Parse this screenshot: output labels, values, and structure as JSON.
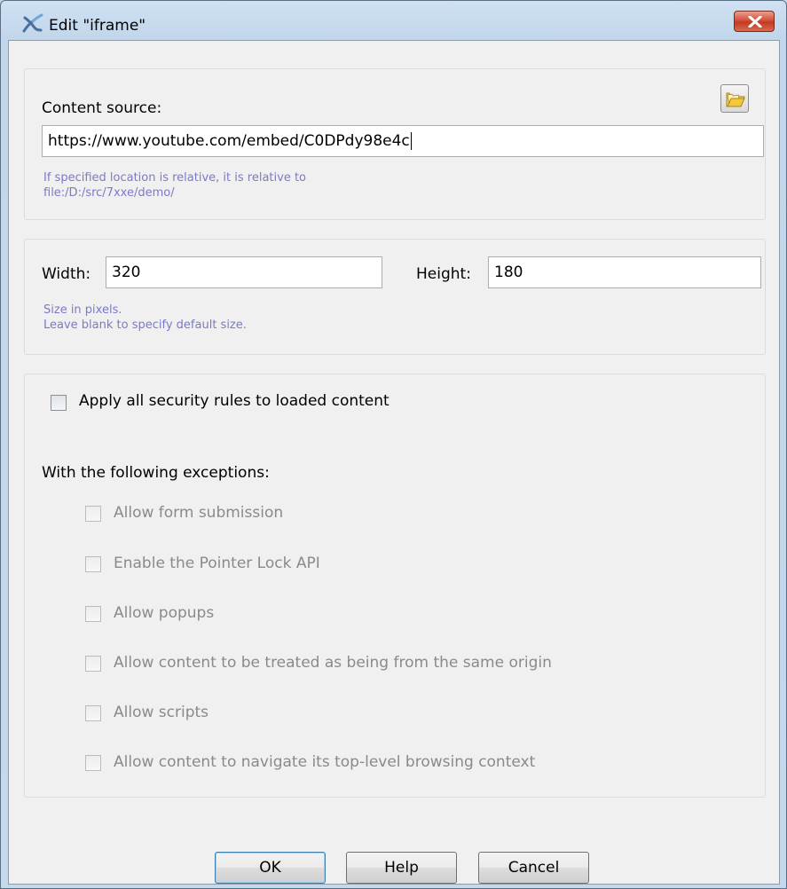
{
  "window": {
    "title": "Edit \"iframe\""
  },
  "source_group": {
    "label": "Content source:",
    "value": "https://www.youtube.com/embed/C0DPdy98e4c",
    "hint_line1": "If specified location is relative, it is relative to",
    "hint_line2": "file:/D:/src/7xxe/demo/"
  },
  "size_group": {
    "width_label": "Width:",
    "width_value": "320",
    "height_label": "Height:",
    "height_value": "180",
    "hint_line1": "Size in pixels.",
    "hint_line2": "Leave blank to specify default size."
  },
  "security_group": {
    "apply_label": "Apply all security rules to loaded content",
    "apply_checked": false,
    "exceptions_label": "With the following exceptions:",
    "exceptions": [
      {
        "label": "Allow form submission",
        "checked": false
      },
      {
        "label": "Enable the Pointer Lock API",
        "checked": false
      },
      {
        "label": "Allow popups",
        "checked": false
      },
      {
        "label": "Allow content to be treated as being from the same origin",
        "checked": false
      },
      {
        "label": "Allow scripts",
        "checked": false
      },
      {
        "label": "Allow content to navigate its top-level browsing context",
        "checked": false
      }
    ]
  },
  "buttons": {
    "ok": "OK",
    "help": "Help",
    "cancel": "Cancel"
  },
  "icons": {
    "title": "xxe-logo-icon",
    "close": "close-icon",
    "browse": "folder-icon"
  },
  "colors": {
    "hint_text": "#7a7ac8",
    "disabled_text": "#8a8a8a",
    "close_button": "#c43a22"
  }
}
